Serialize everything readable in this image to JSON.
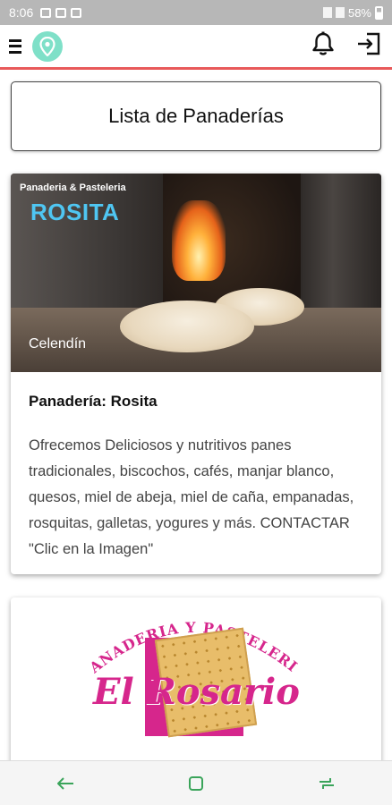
{
  "status_bar": {
    "time": "8:06",
    "battery": "58%"
  },
  "colors": {
    "accent": "#e8595a",
    "logo_bg": "#7fe0c8",
    "brand_blue": "#4fc6f2",
    "brand_pink": "#d6268c",
    "nav_icon": "#3aa45a"
  },
  "icons": {
    "menu": "menu-icon",
    "logo": "map-pin-icon",
    "notifications": "bell-icon",
    "logout": "logout-icon",
    "nav_back": "back-arrow-icon",
    "nav_recents": "recents-icon",
    "nav_home": "home-icon"
  },
  "page": {
    "title": "Lista de Panaderías"
  },
  "cards": [
    {
      "image_subtitle": "Panaderia & Pasteleria",
      "image_name": "ROSITA",
      "image_city": "Celendín",
      "title": "Panadería: Rosita",
      "description": "Ofrecemos Deliciosos y nutritivos panes tradicionales, biscochos, cafés, manjar blanco, quesos, miel de abeja, miel de caña, empanadas, rosquitas, galletas, yogures y más. CONTACTAR \"Clic en la Imagen\""
    },
    {
      "logo_arc_text": "PANADERIA Y PASTELERIA",
      "logo_name": "El Rosario"
    }
  ]
}
